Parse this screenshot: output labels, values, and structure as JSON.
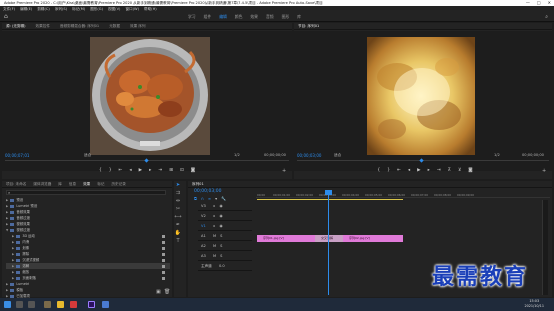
{
  "window": {
    "title": "Adobe Premiere Pro 2020 - C:\\用户\\Kiss\\桌面\\最需教育\\Premiere Pro 2020 从新手到精通\\最需教育\\Premiere Pro 2020从新手到精通\\第7章\\7.4.5\\项目 - Adobe Premiere Pro Auto-Save\\项目",
    "min": "—",
    "max": "□",
    "close": "✕"
  },
  "menu": [
    "文件(F)",
    "编辑(E)",
    "剪辑(C)",
    "序列(S)",
    "标记(M)",
    "图形(G)",
    "视图(V)",
    "窗口(W)",
    "帮助(H)"
  ],
  "workspaces": {
    "tabs": [
      "学习",
      "组件",
      "编辑",
      "颜色",
      "效果",
      "音频",
      "图形",
      "库"
    ],
    "active_index": 2
  },
  "source_monitor": {
    "tabs": [
      "源: (无剪辑)",
      "效果控件",
      "音频剪辑混合器: 序列01",
      "元数据",
      "效果 序列"
    ],
    "active_index": 0,
    "timecode": "00;00;07;01",
    "fit": "适合",
    "scale": "1/2",
    "duration": "00;00;00;00"
  },
  "program_monitor": {
    "tab": "节目: 序列01",
    "timecode": "00;00;03;00",
    "fit": "适合",
    "scale": "1/2",
    "duration": "00;00;00;00"
  },
  "effects_panel": {
    "tabs": [
      "项目: 未命名",
      "媒体浏览器",
      "库",
      "信息",
      "效果",
      "标记",
      "历史记录"
    ],
    "active_index": 4,
    "items": [
      {
        "label": "预设",
        "indent": 0
      },
      {
        "label": "Lumetri 预设",
        "indent": 0
      },
      {
        "label": "音频效果",
        "indent": 0
      },
      {
        "label": "音频过渡",
        "indent": 0
      },
      {
        "label": "视频效果",
        "indent": 0
      },
      {
        "label": "视频过渡",
        "indent": 0
      },
      {
        "label": "3D 运动",
        "indent": 1
      },
      {
        "label": "内滑",
        "indent": 1
      },
      {
        "label": "划像",
        "indent": 1
      },
      {
        "label": "擦除",
        "indent": 1
      },
      {
        "label": "沉浸式视频",
        "indent": 1
      },
      {
        "label": "溶解",
        "indent": 1
      },
      {
        "label": "缩放",
        "indent": 1
      },
      {
        "label": "页面剥落",
        "indent": 1
      },
      {
        "label": "Lumetri",
        "indent": 0
      },
      {
        "label": "模板",
        "indent": 0
      },
      {
        "label": "已加载项",
        "indent": 0
      }
    ]
  },
  "timeline": {
    "tab": "序列01",
    "timecode": "00;00;03;00",
    "ruler": [
      "00;00",
      "00;00;01;00",
      "00;00;02;00",
      "00;00;03;00",
      "00;00;04;00",
      "00;00;05;00",
      "00;00;06;00",
      "00;00;07;00",
      "00;00;08;00",
      "00;00;09;00"
    ],
    "tracks": [
      "V3",
      "V2",
      "V1",
      "A1",
      "A2",
      "A3",
      "主声道"
    ],
    "master_value": "0.0",
    "clips": [
      {
        "label": "序列01.jpg [V]"
      },
      {
        "label": "交叉溶解"
      },
      {
        "label": "序列02.jpg [V]"
      }
    ]
  },
  "taskbar": {
    "time": "15:03",
    "date": "2021/10/11"
  },
  "watermark": "最需教育",
  "colors": {
    "accent": "#2d8ceb",
    "clip": "#e07ad8",
    "panel": "#232323"
  }
}
